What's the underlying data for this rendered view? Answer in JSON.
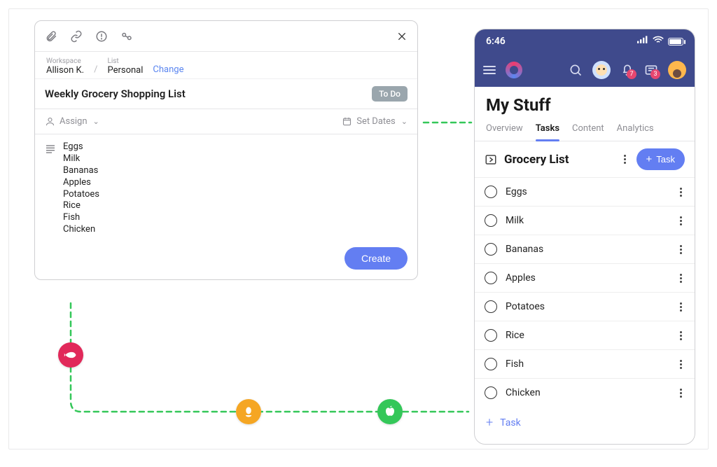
{
  "editor": {
    "breadcrumb": {
      "workspace_label": "Workspace",
      "workspace_value": "Allison K.",
      "list_label": "List",
      "list_value": "Personal",
      "change": "Change"
    },
    "title": "Weekly Grocery Shopping List",
    "status": "To Do",
    "assign_label": "Assign",
    "dates_label": "Set Dates",
    "items": [
      "Eggs",
      "Milk",
      "Bananas",
      "Apples",
      "Potatoes",
      "Rice",
      "Fish",
      "Chicken"
    ],
    "create_label": "Create"
  },
  "connector_nodes": {
    "fish": {
      "color": "#e1295a"
    },
    "egg": {
      "color": "#f5a623"
    },
    "apple": {
      "color": "#34c759"
    }
  },
  "phone": {
    "clock": "6:46",
    "page_title": "My Stuff",
    "tabs": [
      "Overview",
      "Tasks",
      "Content",
      "Analytics"
    ],
    "active_tab": "Tasks",
    "bell_badge": "7",
    "inbox_badge": "3",
    "list": {
      "title": "Grocery List",
      "add_button": "Task",
      "add_row": "Task",
      "items": [
        "Eggs",
        "Milk",
        "Bananas",
        "Apples",
        "Potatoes",
        "Rice",
        "Fish",
        "Chicken"
      ]
    }
  }
}
